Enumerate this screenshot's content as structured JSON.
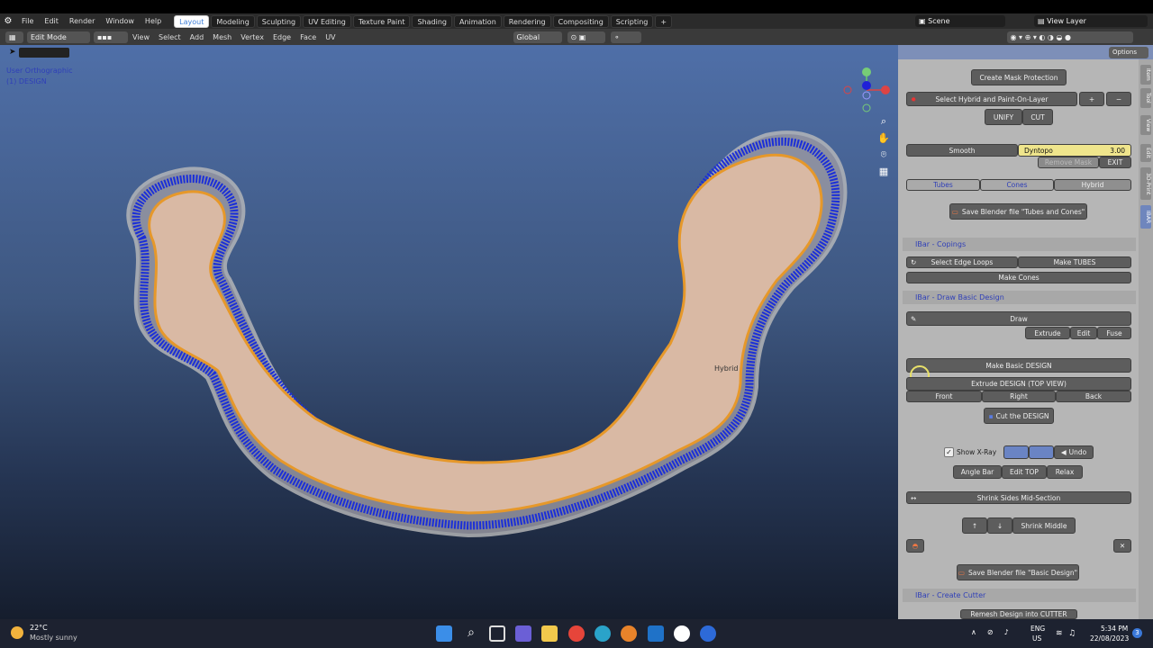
{
  "menu": [
    "File",
    "Edit",
    "Render",
    "Window",
    "Help"
  ],
  "workspaces": [
    "Layout",
    "Modeling",
    "Sculpting",
    "UV Editing",
    "Texture Paint",
    "Shading",
    "Animation",
    "Rendering",
    "Compositing",
    "Scripting"
  ],
  "active_workspace": "Layout",
  "scene": "Scene",
  "view_layer": "View Layer",
  "header": {
    "mode": "Edit Mode",
    "items": [
      "View",
      "Select",
      "Add",
      "Mesh",
      "Vertex",
      "Edge",
      "Face",
      "UV"
    ],
    "orientation": "Global",
    "options": "Options"
  },
  "viewport": {
    "view_name": "User Orthographic",
    "object_name": "(1) DESIGN",
    "hybrid_label": "Hybrid"
  },
  "panel": {
    "create_mask": "Create Mask Protection",
    "select_hybrid": "Select Hybrid and Paint-On-Layer",
    "plus": "+",
    "minus": "−",
    "unify": "UNIFY",
    "cut": "CUT",
    "smooth": "Smooth",
    "dyntopo": "Dyntopo",
    "dyntopo_value": "3.00",
    "remove_mask": "Remove Mask",
    "exit": "EXIT",
    "tubes": "Tubes",
    "cones": "Cones",
    "hybrid": "Hybrid",
    "save_tubes": "Save Blender file \"Tubes and Cones\"",
    "copings_head": "IBar - Copings",
    "select_edge_loops": "Select Edge Loops",
    "make_tubes": "Make TUBES",
    "make_cones": "Make Cones",
    "draw_head": "IBar - Draw Basic Design",
    "draw": "Draw",
    "extrude": "Extrude",
    "edit": "Edit",
    "fuse": "Fuse",
    "make_basic": "Make  Basic DESIGN",
    "extrude_design": "Extrude  DESIGN (TOP VIEW)",
    "front": "Front",
    "right": "Right",
    "back": "Back",
    "cut_design": "Cut the DESIGN",
    "show_xray": "Show X-Ray",
    "undo": "Undo",
    "angle_bar": "Angle Bar",
    "edit_top": "Edit TOP",
    "relax": "Relax",
    "shrink_sides": "Shrink Sides Mid-Section",
    "shrink_middle": "Shrink Middle",
    "close": "✕",
    "save_basic": "Save Blender file \"Basic Design\"",
    "cutter_head": "IBar - Create Cutter",
    "remesh": "Remesh Design into CUTTER"
  },
  "side_tabs": [
    "Item",
    "Tool",
    "View",
    "Edit",
    "3D-Print",
    "IBAR"
  ],
  "taskbar": {
    "temp": "22°C",
    "weather": "Mostly sunny",
    "lang1": "ENG",
    "lang2": "US",
    "time": "5:34 PM",
    "date": "22/08/2023",
    "notif": "3"
  }
}
